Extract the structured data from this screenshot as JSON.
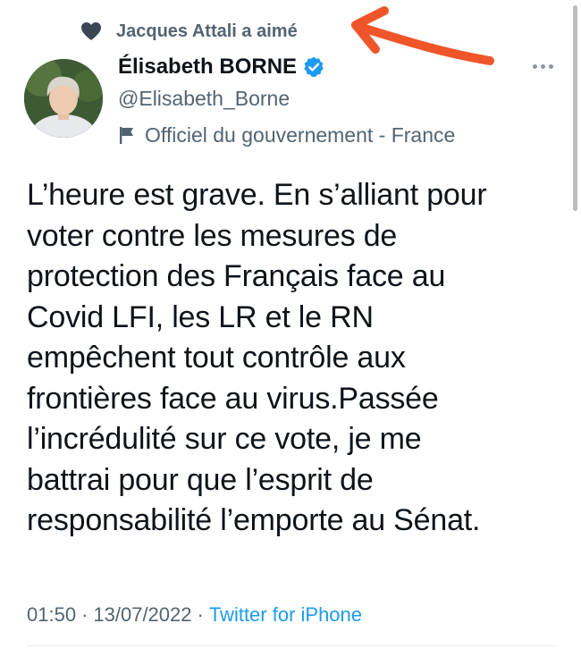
{
  "social_context": {
    "text": "Jacques Attali a aimé",
    "icon": "heart-icon"
  },
  "author": {
    "display_name": "Élisabeth BORNE",
    "handle": "@Elisabeth_Borne",
    "verified": true,
    "label": "Officiel du gouvernement - France",
    "label_icon": "flag-icon"
  },
  "tweet": {
    "text": "L’heure est grave. En s’alliant pour\nvoter contre les mesures de\nprotection des Français face au\nCovid LFI, les LR et le RN\nempêchent tout contrôle aux\nfrontières face au virus.Passée\nl’incrédulité sur ce vote, je me\nbattrai pour que l’esprit de\nresponsabilité l’emporte au Sénat.",
    "time": "01:50",
    "separator": "·",
    "date": "13/07/2022",
    "source": "Twitter for iPhone"
  },
  "colors": {
    "accent": "#1d9bf0",
    "secondary_text": "#536471",
    "primary_text": "#0f1419",
    "annotation_arrow": "#f0552a"
  }
}
